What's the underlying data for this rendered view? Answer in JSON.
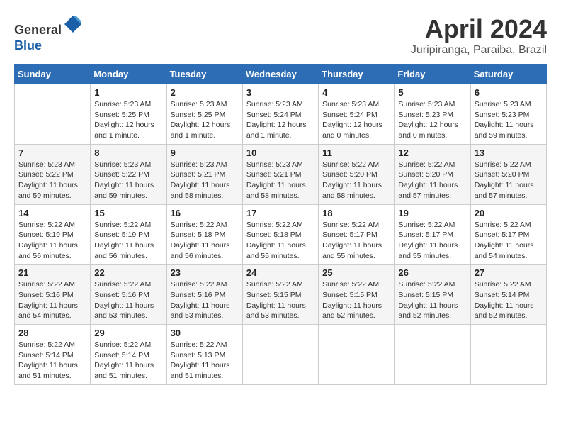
{
  "header": {
    "logo_line1": "General",
    "logo_line2": "Blue",
    "month_title": "April 2024",
    "location": "Juripiranga, Paraiba, Brazil"
  },
  "days_of_week": [
    "Sunday",
    "Monday",
    "Tuesday",
    "Wednesday",
    "Thursday",
    "Friday",
    "Saturday"
  ],
  "weeks": [
    [
      {
        "day": "",
        "info": ""
      },
      {
        "day": "1",
        "info": "Sunrise: 5:23 AM\nSunset: 5:25 PM\nDaylight: 12 hours\nand 1 minute."
      },
      {
        "day": "2",
        "info": "Sunrise: 5:23 AM\nSunset: 5:25 PM\nDaylight: 12 hours\nand 1 minute."
      },
      {
        "day": "3",
        "info": "Sunrise: 5:23 AM\nSunset: 5:24 PM\nDaylight: 12 hours\nand 1 minute."
      },
      {
        "day": "4",
        "info": "Sunrise: 5:23 AM\nSunset: 5:24 PM\nDaylight: 12 hours\nand 0 minutes."
      },
      {
        "day": "5",
        "info": "Sunrise: 5:23 AM\nSunset: 5:23 PM\nDaylight: 12 hours\nand 0 minutes."
      },
      {
        "day": "6",
        "info": "Sunrise: 5:23 AM\nSunset: 5:23 PM\nDaylight: 11 hours\nand 59 minutes."
      }
    ],
    [
      {
        "day": "7",
        "info": "Sunrise: 5:23 AM\nSunset: 5:22 PM\nDaylight: 11 hours\nand 59 minutes."
      },
      {
        "day": "8",
        "info": "Sunrise: 5:23 AM\nSunset: 5:22 PM\nDaylight: 11 hours\nand 59 minutes."
      },
      {
        "day": "9",
        "info": "Sunrise: 5:23 AM\nSunset: 5:21 PM\nDaylight: 11 hours\nand 58 minutes."
      },
      {
        "day": "10",
        "info": "Sunrise: 5:23 AM\nSunset: 5:21 PM\nDaylight: 11 hours\nand 58 minutes."
      },
      {
        "day": "11",
        "info": "Sunrise: 5:22 AM\nSunset: 5:20 PM\nDaylight: 11 hours\nand 58 minutes."
      },
      {
        "day": "12",
        "info": "Sunrise: 5:22 AM\nSunset: 5:20 PM\nDaylight: 11 hours\nand 57 minutes."
      },
      {
        "day": "13",
        "info": "Sunrise: 5:22 AM\nSunset: 5:20 PM\nDaylight: 11 hours\nand 57 minutes."
      }
    ],
    [
      {
        "day": "14",
        "info": "Sunrise: 5:22 AM\nSunset: 5:19 PM\nDaylight: 11 hours\nand 56 minutes."
      },
      {
        "day": "15",
        "info": "Sunrise: 5:22 AM\nSunset: 5:19 PM\nDaylight: 11 hours\nand 56 minutes."
      },
      {
        "day": "16",
        "info": "Sunrise: 5:22 AM\nSunset: 5:18 PM\nDaylight: 11 hours\nand 56 minutes."
      },
      {
        "day": "17",
        "info": "Sunrise: 5:22 AM\nSunset: 5:18 PM\nDaylight: 11 hours\nand 55 minutes."
      },
      {
        "day": "18",
        "info": "Sunrise: 5:22 AM\nSunset: 5:17 PM\nDaylight: 11 hours\nand 55 minutes."
      },
      {
        "day": "19",
        "info": "Sunrise: 5:22 AM\nSunset: 5:17 PM\nDaylight: 11 hours\nand 55 minutes."
      },
      {
        "day": "20",
        "info": "Sunrise: 5:22 AM\nSunset: 5:17 PM\nDaylight: 11 hours\nand 54 minutes."
      }
    ],
    [
      {
        "day": "21",
        "info": "Sunrise: 5:22 AM\nSunset: 5:16 PM\nDaylight: 11 hours\nand 54 minutes."
      },
      {
        "day": "22",
        "info": "Sunrise: 5:22 AM\nSunset: 5:16 PM\nDaylight: 11 hours\nand 53 minutes."
      },
      {
        "day": "23",
        "info": "Sunrise: 5:22 AM\nSunset: 5:16 PM\nDaylight: 11 hours\nand 53 minutes."
      },
      {
        "day": "24",
        "info": "Sunrise: 5:22 AM\nSunset: 5:15 PM\nDaylight: 11 hours\nand 53 minutes."
      },
      {
        "day": "25",
        "info": "Sunrise: 5:22 AM\nSunset: 5:15 PM\nDaylight: 11 hours\nand 52 minutes."
      },
      {
        "day": "26",
        "info": "Sunrise: 5:22 AM\nSunset: 5:15 PM\nDaylight: 11 hours\nand 52 minutes."
      },
      {
        "day": "27",
        "info": "Sunrise: 5:22 AM\nSunset: 5:14 PM\nDaylight: 11 hours\nand 52 minutes."
      }
    ],
    [
      {
        "day": "28",
        "info": "Sunrise: 5:22 AM\nSunset: 5:14 PM\nDaylight: 11 hours\nand 51 minutes."
      },
      {
        "day": "29",
        "info": "Sunrise: 5:22 AM\nSunset: 5:14 PM\nDaylight: 11 hours\nand 51 minutes."
      },
      {
        "day": "30",
        "info": "Sunrise: 5:22 AM\nSunset: 5:13 PM\nDaylight: 11 hours\nand 51 minutes."
      },
      {
        "day": "",
        "info": ""
      },
      {
        "day": "",
        "info": ""
      },
      {
        "day": "",
        "info": ""
      },
      {
        "day": "",
        "info": ""
      }
    ]
  ]
}
